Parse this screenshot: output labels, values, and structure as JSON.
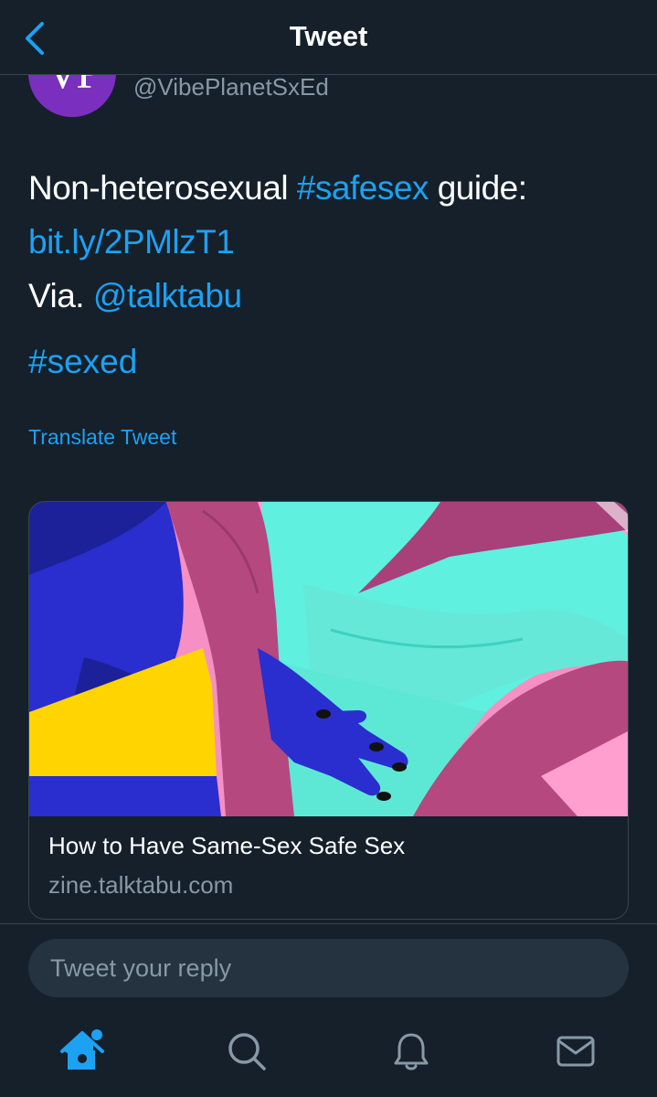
{
  "nav": {
    "title": "Tweet",
    "back_icon": "chevron-left-icon"
  },
  "author": {
    "avatar_initials": "VP",
    "handle": "@VibePlanetSxEd"
  },
  "tweet": {
    "line1_prefix": "Non-heterosexual ",
    "line1_hashtag": "#safesex",
    "line1_suffix": " guide:",
    "line2_link": "bit.ly/2PMlzT1",
    "line3_prefix": "Via. ",
    "line3_mention": "@talktabu",
    "hashtag_line": "#sexed",
    "translate_label": "Translate Tweet"
  },
  "card": {
    "title": "How to Have Same-Sex Safe Sex",
    "domain": "zine.talktabu.com",
    "image_desc_icon": "illustration-image"
  },
  "reply": {
    "placeholder": "Tweet your reply"
  },
  "tabbar": {
    "items": [
      {
        "name": "home",
        "icon": "home-icon",
        "active": true
      },
      {
        "name": "search",
        "icon": "search-icon",
        "active": false
      },
      {
        "name": "notifications",
        "icon": "bell-icon",
        "active": false
      },
      {
        "name": "messages",
        "icon": "mail-icon",
        "active": false
      }
    ]
  },
  "colors": {
    "background": "#15202b",
    "accent": "#1da1f2",
    "muted_text": "#8899a6",
    "divider": "#38444d",
    "input_bg": "#253341"
  }
}
